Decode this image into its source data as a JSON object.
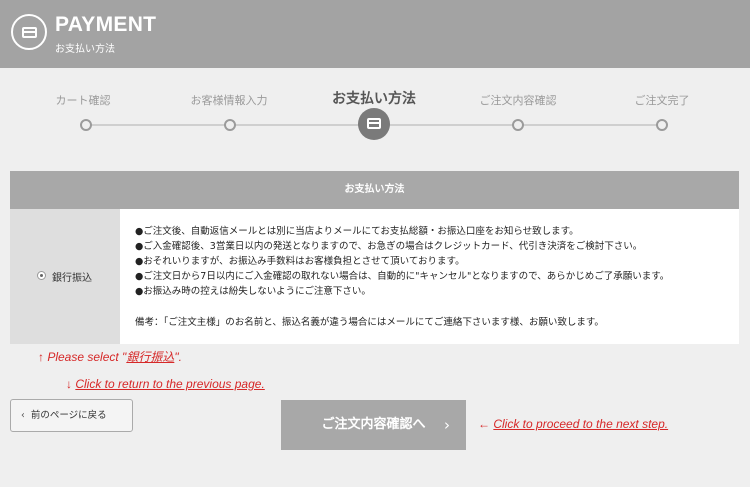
{
  "header": {
    "title": "PAYMENT",
    "subtitle": "お支払い方法",
    "icon": "credit-card-icon"
  },
  "steps": [
    {
      "label": "カート確認",
      "active": false
    },
    {
      "label": "お客様情報入力",
      "active": false
    },
    {
      "label": "お支払い方法",
      "active": true
    },
    {
      "label": "ご注文内容確認",
      "active": false
    },
    {
      "label": "ご注文完了",
      "active": false
    }
  ],
  "payment": {
    "heading": "お支払い方法",
    "method_label": "銀行振込",
    "notes": [
      "●ご注文後、自動返信メールとは別に当店よりメールにてお支払総額・お振込口座をお知らせ致します。",
      "●ご入金確認後、3営業日以内の発送となりますので、お急ぎの場合はクレジットカード、代引き決済をご検討下さい。",
      "●おそれいりますが、お振込み手数料はお客様負担とさせて頂いております。",
      "●ご注文日から7日以内にご入金確認の取れない場合は、自動的に\"キャンセル\"となりますので、あらかじめご了承願います。",
      "●お振込み時の控えは紛失しないようにご注意下さい。"
    ],
    "remark": "備考：「ご注文主様」のお名前と、振込名義が違う場合にはメールにてご連絡下さいます様、お願い致します。"
  },
  "annotations": {
    "select_prefix": "↑ Please select \"",
    "select_target": "銀行振込",
    "select_suffix": "\".",
    "return_arrow": "↓ ",
    "return_text": "Click to return to the previous page.",
    "proceed_arrow": "← ",
    "proceed_text": "Click to proceed to the next step."
  },
  "buttons": {
    "back_label": "前のページに戻る",
    "next_label": "ご注文内容確認へ"
  },
  "colors": {
    "header_bg": "#a3a3a3",
    "annotation_red": "#d62828",
    "button_gray": "#a8a8a8"
  }
}
